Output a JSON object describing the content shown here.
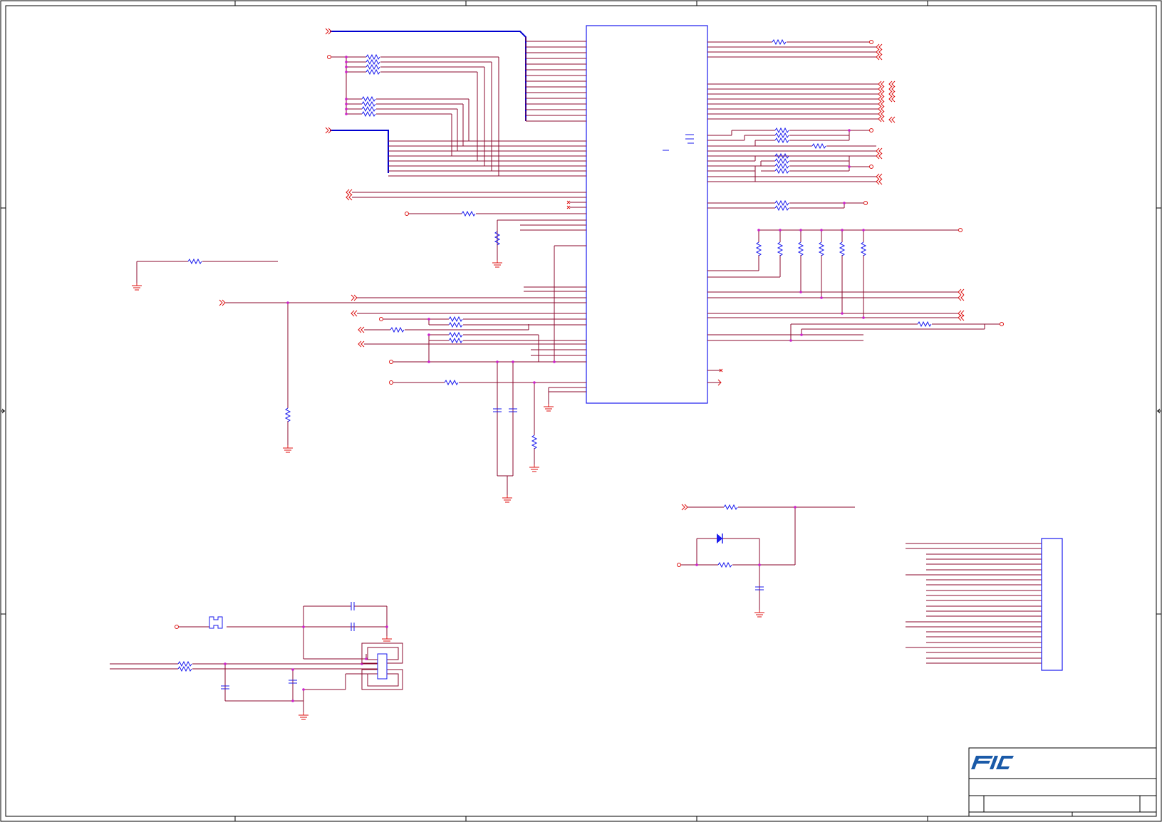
{
  "sheet": {
    "description": "",
    "colors": {
      "wire": "#8b0a2e",
      "bus": "#0000d0",
      "port": "#dd1111",
      "junction": "#cc22cc",
      "part": "#1a1aee",
      "frame": "#000000",
      "logo": "#1a5aa8"
    }
  },
  "title_block": {
    "logo_text": "FIC",
    "title": "",
    "doc_number": "",
    "rev": ""
  }
}
